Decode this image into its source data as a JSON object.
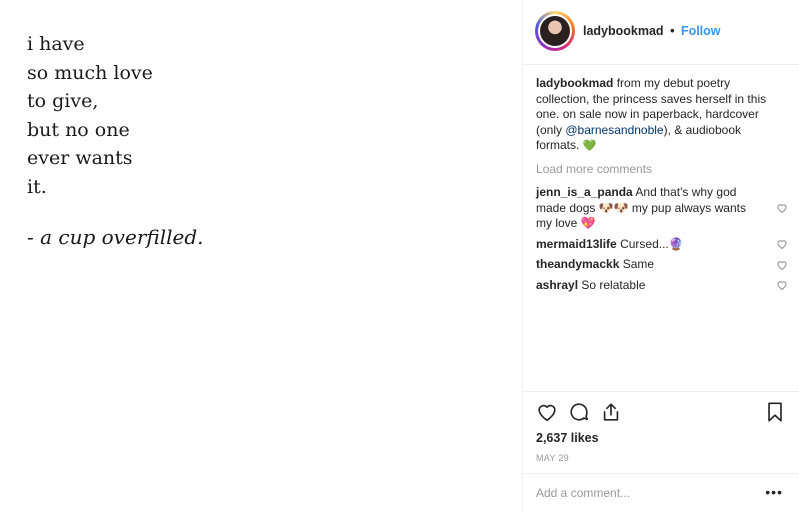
{
  "post": {
    "poem_lines": [
      "i have",
      "so much love",
      "to give,",
      "but no one",
      "ever wants",
      "it."
    ],
    "signature": "- a cup overfilled."
  },
  "header": {
    "username": "ladybookmad",
    "separator": "•",
    "follow_label": "Follow"
  },
  "caption": {
    "username": "ladybookmad",
    "text_before_mention": "from my debut poetry collection, the princess saves herself in this one. on sale now in paperback, hardcover (only ",
    "mention": "@barnesandnoble",
    "text_after_mention": "), & audiobook formats.",
    "emoji": "💚"
  },
  "load_more_label": "Load more comments",
  "comments": [
    {
      "username": "jenn_is_a_panda",
      "text": "And that's why god made dogs 🐶🐶 my pup always wants my love 💖"
    },
    {
      "username": "mermaid13life",
      "text": "Cursed...🔮"
    },
    {
      "username": "theandymackk",
      "text": "Same"
    },
    {
      "username": "ashrayl",
      "text": "So relatable"
    }
  ],
  "likes": "2,637 likes",
  "date": "MAY 29",
  "add_comment_placeholder": "Add a comment...",
  "more_label": "•••",
  "colors": {
    "link": "#3897f0",
    "mention": "#003569",
    "muted": "#999999",
    "text": "#262626"
  },
  "icons": [
    "heart-icon",
    "comment-icon",
    "share-icon",
    "bookmark-icon",
    "more-options-icon"
  ]
}
